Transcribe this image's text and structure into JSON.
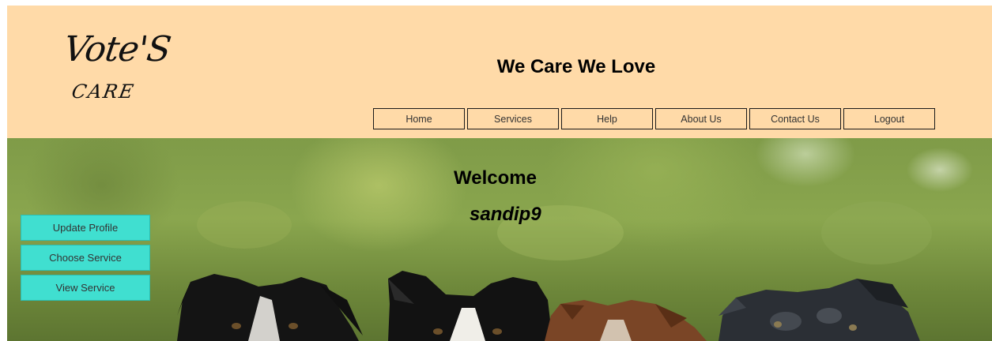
{
  "logo": {
    "line1": "Vote'S",
    "line2": "CARE"
  },
  "header": {
    "title": "We Care We Love"
  },
  "nav": {
    "items": [
      {
        "label": "Home"
      },
      {
        "label": "Services"
      },
      {
        "label": "Help"
      },
      {
        "label": "About Us"
      },
      {
        "label": "Contact Us"
      },
      {
        "label": "Logout"
      }
    ]
  },
  "hero": {
    "welcome": "Welcome",
    "username": "sandip9"
  },
  "side_menu": {
    "items": [
      {
        "label": "Update Profile"
      },
      {
        "label": "Choose Service"
      },
      {
        "label": "View Service"
      }
    ]
  },
  "colors": {
    "header_bg": "#ffdaa8",
    "side_button_bg": "#40dfd0",
    "text": "#000000"
  },
  "image": {
    "subject": "dogs-photo"
  }
}
